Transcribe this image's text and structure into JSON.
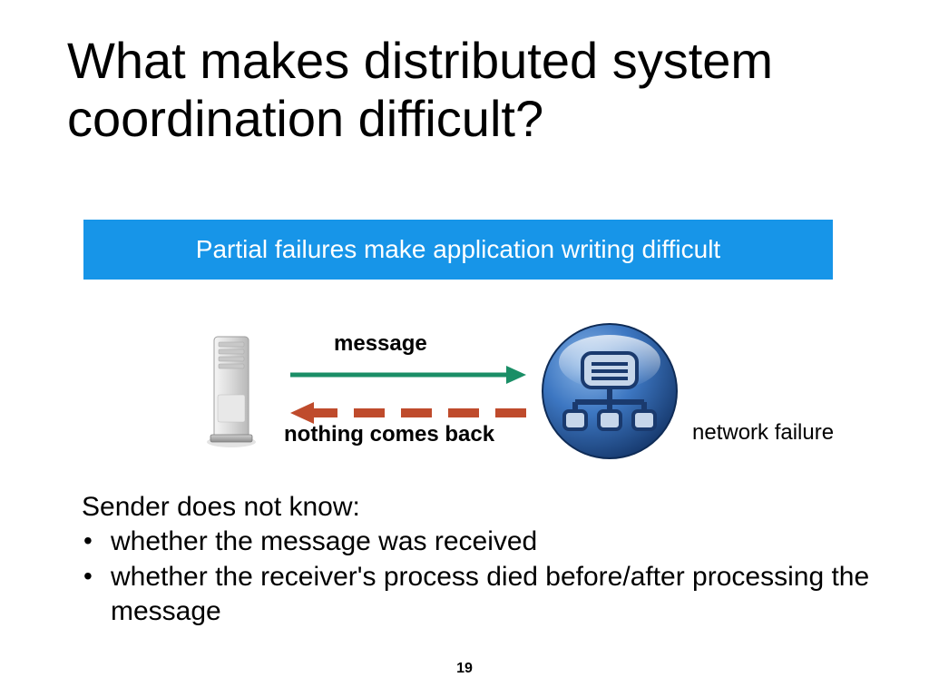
{
  "title": "What makes distributed system coordination difficult?",
  "banner": "Partial failures make application writing difficult",
  "diagram": {
    "msg_label": "message",
    "nothing_label": "nothing comes back",
    "network_label": "network failure",
    "arrow_color_send": "#1a8e66",
    "arrow_color_return": "#bf4b2c"
  },
  "body": {
    "lead": "Sender does not know:",
    "bullets": [
      "whether the message was received",
      "whether the receiver's process died before/after processing the message"
    ]
  },
  "page_number": "19",
  "colors": {
    "banner_bg": "#1795e8",
    "network_icon_main": "#3d77c2",
    "network_icon_dark": "#1a3a6e"
  }
}
